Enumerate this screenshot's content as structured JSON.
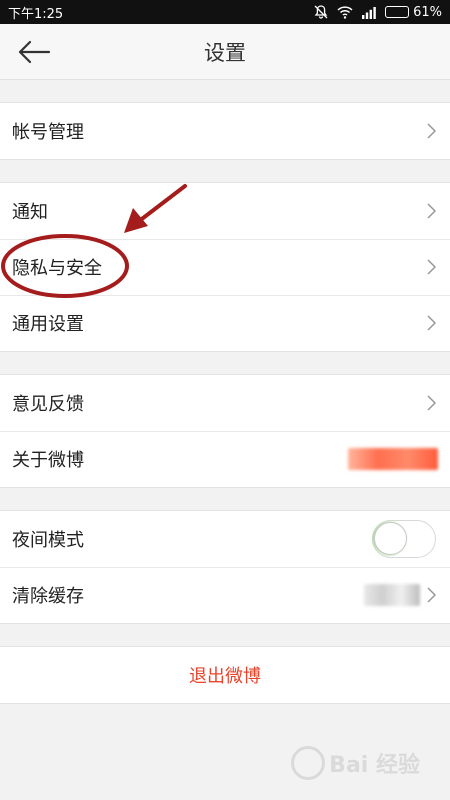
{
  "status_bar": {
    "time": "下午1:25",
    "battery_percent": "61%",
    "battery_level": 0.61
  },
  "header": {
    "title": "设置"
  },
  "groups": [
    {
      "items": [
        {
          "label": "帐号管理"
        }
      ]
    },
    {
      "items": [
        {
          "label": "通知"
        },
        {
          "label": "隐私与安全"
        },
        {
          "label": "通用设置"
        }
      ]
    },
    {
      "items": [
        {
          "label": "意见反馈"
        },
        {
          "label": "关于微博"
        }
      ]
    },
    {
      "items": [
        {
          "label": "夜间模式",
          "toggle": false
        },
        {
          "label": "清除缓存"
        }
      ]
    }
  ],
  "logout": {
    "label": "退出微博"
  },
  "colors": {
    "accent": "#e8452c",
    "annotation": "#a51c1c"
  },
  "watermark": {
    "text": "Bai 经验"
  }
}
